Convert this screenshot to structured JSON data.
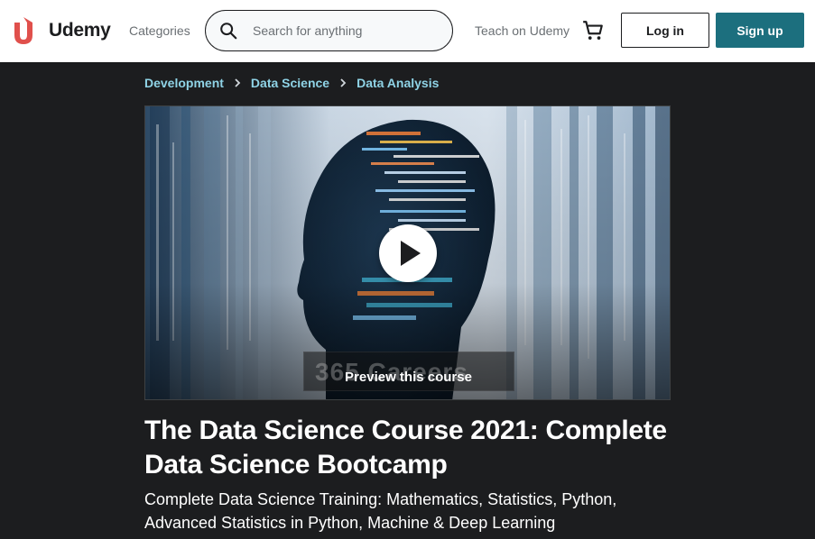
{
  "header": {
    "logo_text": "Udemy",
    "categories_label": "Categories",
    "search_placeholder": "Search for anything",
    "teach_label": "Teach on Udemy",
    "login_label": "Log in",
    "signup_label": "Sign up"
  },
  "breadcrumb": [
    "Development",
    "Data Science",
    "Data Analysis"
  ],
  "preview": {
    "label": "Preview this course",
    "watermark_text": "365 Careers"
  },
  "course": {
    "title": "The Data Science Course 2021: Complete Data Science Bootcamp",
    "subtitle": "Complete Data Science Training: Mathematics, Statistics, Python, Advanced Statistics in Python, Machine & Deep Learning"
  },
  "colors": {
    "brand": "#a435f0",
    "signup_bg": "#1c6f7e",
    "breadcrumb_link": "#8fd3e6",
    "page_bg": "#1c1d1f"
  },
  "icons": {
    "logo": "udemy-logo-icon",
    "search": "search-icon",
    "cart": "cart-icon",
    "play": "play-icon",
    "chevron": "chevron-right-icon"
  }
}
